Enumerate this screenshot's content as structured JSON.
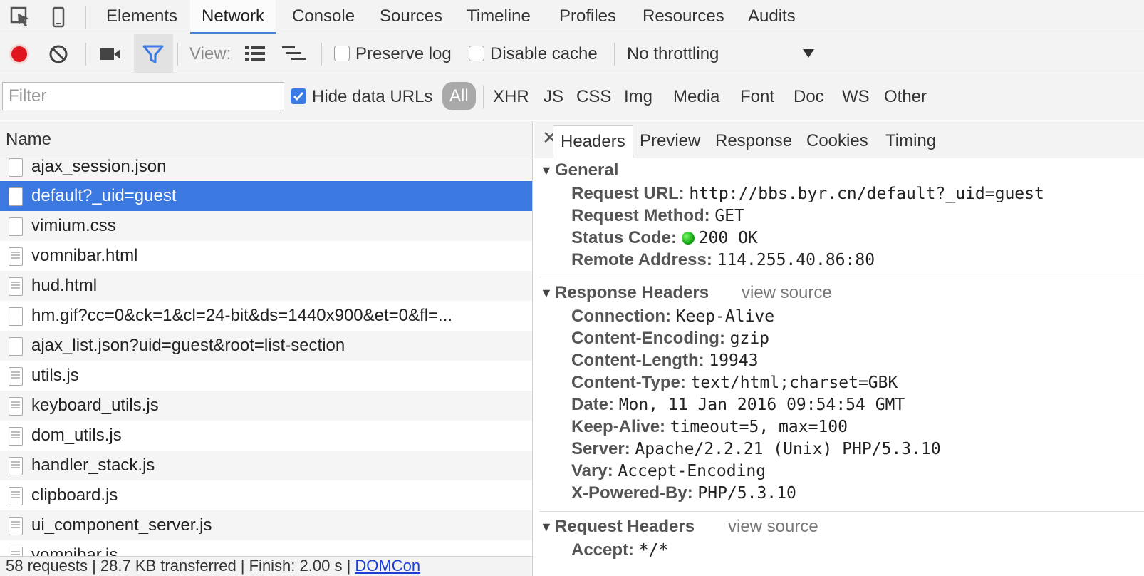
{
  "topbar": {
    "tabs": [
      "Elements",
      "Network",
      "Console",
      "Sources",
      "Timeline",
      "Profiles",
      "Resources",
      "Audits"
    ],
    "active_tab": "Network"
  },
  "toolbar": {
    "view_label": "View:",
    "preserve_log": "Preserve log",
    "disable_cache": "Disable cache",
    "throttling": "No throttling"
  },
  "filterbar": {
    "filter_placeholder": "Filter",
    "hide_data_urls": "Hide data URLs",
    "types": [
      "All",
      "XHR",
      "JS",
      "CSS",
      "Img",
      "Media",
      "Font",
      "Doc",
      "WS",
      "Other"
    ]
  },
  "request_list": {
    "header": "Name",
    "rows": [
      "ajax_session.json",
      "default?_uid=guest",
      "vimium.css",
      "vomnibar.html",
      "hud.html",
      "hm.gif?cc=0&ck=1&cl=24-bit&ds=1440x900&et=0&fl=...",
      "ajax_list.json?uid=guest&root=list-section",
      "utils.js",
      "keyboard_utils.js",
      "dom_utils.js",
      "handler_stack.js",
      "clipboard.js",
      "ui_component_server.js",
      "vomnibar.js"
    ],
    "selected_index": 1,
    "status_summary": "58 requests | 28.7 KB transferred | Finish: 2.00 s | ",
    "status_link": "DOMCon"
  },
  "details": {
    "tabs": [
      "Headers",
      "Preview",
      "Response",
      "Cookies",
      "Timing"
    ],
    "active_tab": "Headers",
    "view_source_label": "view source",
    "general": {
      "title": "General",
      "items": [
        {
          "k": "Request URL:",
          "v": "http://bbs.byr.cn/default?_uid=guest"
        },
        {
          "k": "Request Method:",
          "v": "GET"
        },
        {
          "k": "Status Code:",
          "v": "200 OK"
        },
        {
          "k": "Remote Address:",
          "v": "114.255.40.86:80"
        }
      ]
    },
    "response_headers": {
      "title": "Response Headers",
      "items": [
        {
          "k": "Connection:",
          "v": "Keep-Alive"
        },
        {
          "k": "Content-Encoding:",
          "v": "gzip"
        },
        {
          "k": "Content-Length:",
          "v": "19943"
        },
        {
          "k": "Content-Type:",
          "v": "text/html;charset=GBK"
        },
        {
          "k": "Date:",
          "v": "Mon, 11 Jan 2016 09:54:54 GMT"
        },
        {
          "k": "Keep-Alive:",
          "v": "timeout=5, max=100"
        },
        {
          "k": "Server:",
          "v": "Apache/2.2.21 (Unix) PHP/5.3.10"
        },
        {
          "k": "Vary:",
          "v": "Accept-Encoding"
        },
        {
          "k": "X-Powered-By:",
          "v": "PHP/5.3.10"
        }
      ]
    },
    "request_headers": {
      "title": "Request Headers",
      "items": [
        {
          "k": "Accept:",
          "v": "*/*"
        }
      ]
    }
  },
  "colors": {
    "accent": "#3b78e0",
    "record": "#e0141c",
    "status_ok": "#13a813"
  }
}
